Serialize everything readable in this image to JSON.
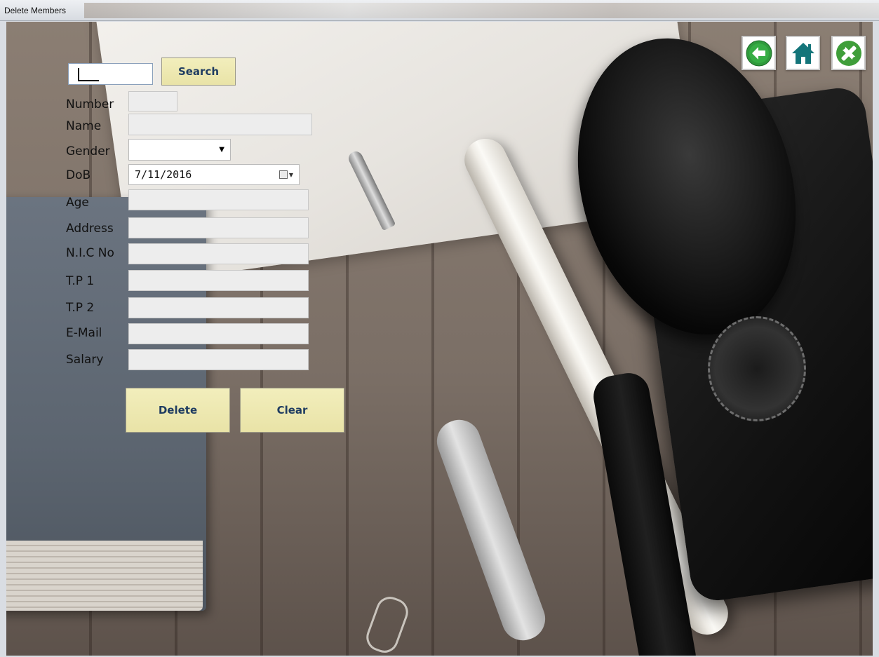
{
  "window": {
    "title": "Delete Members"
  },
  "search": {
    "value": "",
    "button_label": "Search"
  },
  "form": {
    "number_label": "Number",
    "name_label": "Name",
    "gender_label": "Gender",
    "gender_value": "",
    "dob_label": "DoB",
    "dob_value": "7/11/2016",
    "age_label": "Age",
    "address_label": "Address",
    "nic_label": "N.I.C No",
    "tp1_label": "T.P 1",
    "tp2_label": "T.P 2",
    "email_label": "E-Mail",
    "salary_label": "Salary"
  },
  "actions": {
    "delete_label": "Delete",
    "clear_label": "Clear"
  },
  "icons": {
    "back": "back-arrow-icon",
    "home": "home-icon",
    "settings": "tools-icon"
  },
  "colors": {
    "button_bg": "#e9e3a7",
    "button_text": "#1f3c61",
    "icon_green": "#2f9a3c",
    "icon_teal": "#14757a"
  }
}
